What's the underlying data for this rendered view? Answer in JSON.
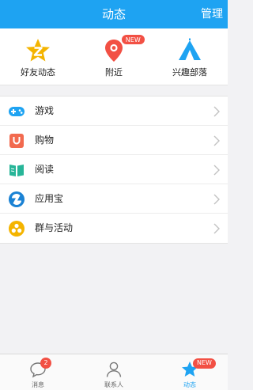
{
  "header": {
    "title": "动态",
    "manage": "管理"
  },
  "quick": [
    {
      "label": "好友动态",
      "icon": "qzone-star-icon"
    },
    {
      "label": "附近",
      "icon": "location-pin-icon",
      "badge": "NEW"
    },
    {
      "label": "兴趣部落",
      "icon": "tent-icon"
    }
  ],
  "list": [
    {
      "label": "游戏",
      "icon": "gamepad-icon"
    },
    {
      "label": "购物",
      "icon": "shopping-bag-icon"
    },
    {
      "label": "阅读",
      "icon": "book-icon"
    },
    {
      "label": "应用宝",
      "icon": "app-store-icon"
    },
    {
      "label": "群与活动",
      "icon": "group-icon"
    }
  ],
  "tabs": [
    {
      "label": "消息",
      "icon": "message-icon",
      "count": "2"
    },
    {
      "label": "联系人",
      "icon": "contacts-icon"
    },
    {
      "label": "动态",
      "icon": "star-icon",
      "badge": "NEW",
      "active": true
    }
  ],
  "colors": {
    "accent": "#1ea3f2",
    "badge": "#f25044",
    "star": "#f4b400"
  }
}
